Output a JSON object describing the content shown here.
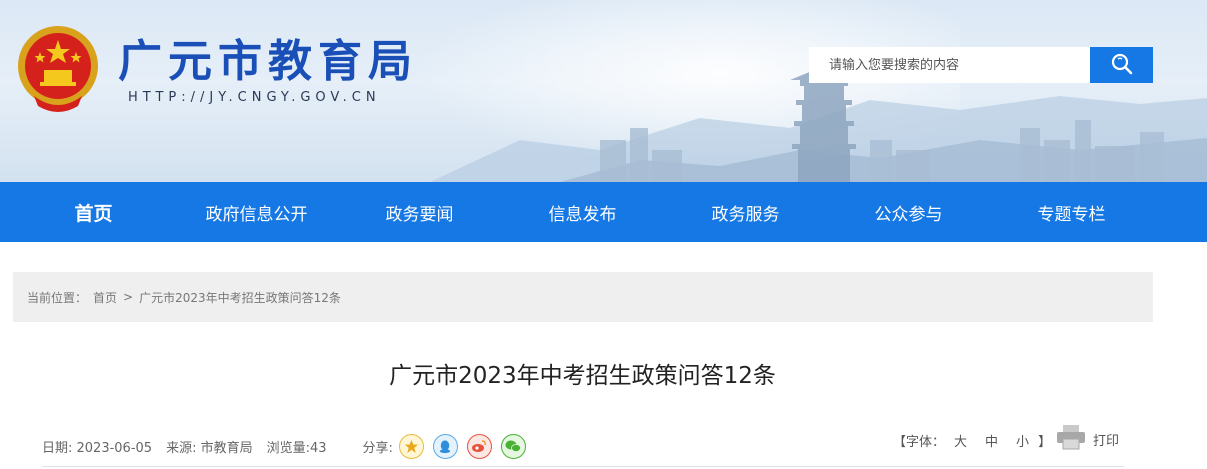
{
  "header": {
    "site_title": "广元市教育局",
    "site_url": "HTTP://JY.CNGY.GOV.CN",
    "emblem_icon": "national-emblem-icon"
  },
  "search": {
    "placeholder": "请输入您要搜索的内容",
    "button_icon": "search-icon"
  },
  "nav": {
    "items": [
      {
        "label": "首页",
        "active": true
      },
      {
        "label": "政府信息公开"
      },
      {
        "label": "政务要闻"
      },
      {
        "label": "信息发布"
      },
      {
        "label": "政务服务"
      },
      {
        "label": "公众参与"
      },
      {
        "label": "专题专栏"
      }
    ]
  },
  "breadcrumb": {
    "prefix": "当前位置：",
    "home": "首页",
    "separator": ">",
    "current": "广元市2023年中考招生政策问答12条"
  },
  "article": {
    "title": "广元市2023年中考招生政策问答12条",
    "date": "日期: 2023-06-05",
    "source": "来源: 市教育局",
    "views": "浏览量:43",
    "share_label": "分享:",
    "share_icons": [
      "qzone-icon",
      "qq-icon",
      "weibo-icon",
      "wechat-icon"
    ]
  },
  "font_size": {
    "open": "【字体：",
    "large": "大",
    "medium": "中",
    "small": "小",
    "close": "】"
  },
  "print": {
    "label": "打印",
    "icon": "printer-icon"
  },
  "colors": {
    "brand_blue": "#1678e5",
    "title_blue": "#1a4fb8"
  }
}
